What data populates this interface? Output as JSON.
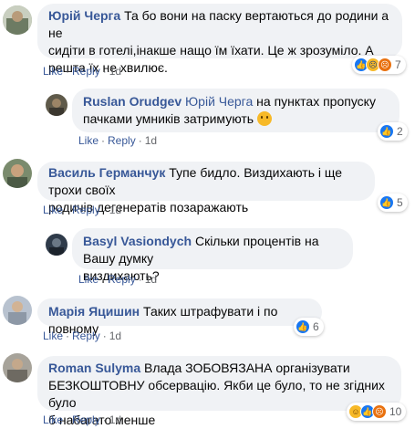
{
  "comments": [
    {
      "author": "Юрій Черга",
      "text_line1": "Та бо вони на паску вертаються до родини а не",
      "text_line2": "сидіти в готелі,інакше нащо їм їхати. Це ж зрозуміло. А",
      "text_line3": "решта їх не хвилює.",
      "like": "Like",
      "reply": "Reply",
      "time": "1d",
      "reactions": [
        "like-icon",
        "sad-icon",
        "angry-icon"
      ],
      "reaction_count": "7"
    },
    {
      "author": "Ruslan Orudgev",
      "mention": "Юрій Черга",
      "text_line1": "на пунктах пропуску",
      "text_line2": "пачками умників затримують",
      "like": "Like",
      "reply": "Reply",
      "time": "1d",
      "reactions": [
        "like-icon"
      ],
      "reaction_count": "2"
    },
    {
      "author": "Василь Германчук",
      "text_line1": "Тупе бидло. Виздихають і ще трохи своїх",
      "text_line2": "родичів дегенератів позаражають",
      "like": "Like",
      "reply": "Reply",
      "time": "1d",
      "reactions": [
        "like-icon"
      ],
      "reaction_count": "5"
    },
    {
      "author": "Basyl Vasiondych",
      "text_line1": "Скільки процентів на Вашу думку",
      "text_line2": "виздихають?",
      "like": "Like",
      "reply": "Reply",
      "time": "1d"
    },
    {
      "author": "Марія Яцишин",
      "text_line1": "Таких штрафувати і по повному",
      "like": "Like",
      "reply": "Reply",
      "time": "1d",
      "reactions": [
        "like-icon"
      ],
      "reaction_count": "6"
    },
    {
      "author": "Roman Sulyma",
      "text_line1": "Влада ЗОБОВЯЗАНА організувати",
      "text_line2": "БЕЗКОШТОВНУ обсервацію. Якби це було, то не згідних було",
      "text_line3": "б набагато менше",
      "like": "Like",
      "reply": "Reply",
      "time": "1d",
      "reactions": [
        "haha-icon",
        "like-icon",
        "angry-icon"
      ],
      "reaction_count": "10"
    }
  ],
  "colors": {
    "link": "#385898",
    "bubble": "#f0f2f5",
    "like": "#1877f2",
    "angry": "#e9710f",
    "haha": "#f7b928"
  }
}
